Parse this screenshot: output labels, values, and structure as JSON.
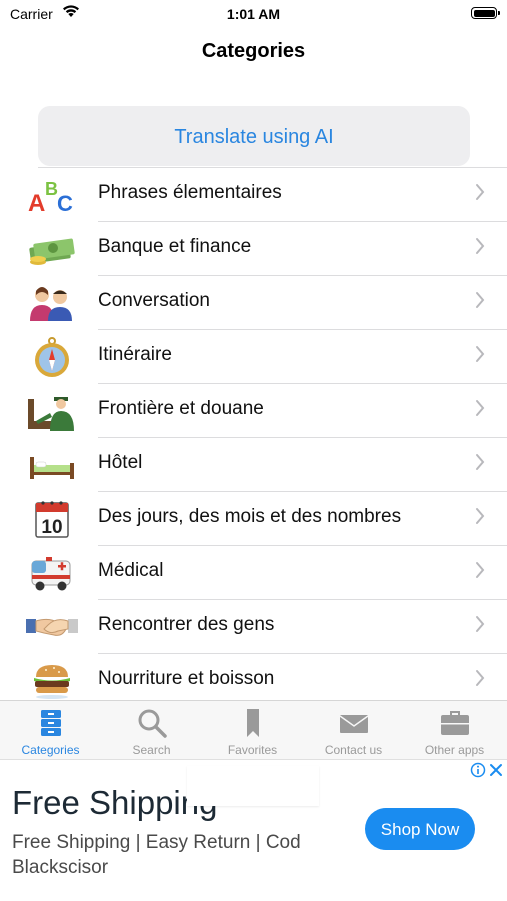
{
  "status_bar": {
    "carrier": "Carrier",
    "time": "1:01 AM"
  },
  "nav": {
    "title": "Categories"
  },
  "ai_button": {
    "label": "Translate using AI"
  },
  "categories": [
    {
      "label": "Phrases élementaires",
      "icon": "abc-blocks-icon"
    },
    {
      "label": "Banque et finance",
      "icon": "money-icon"
    },
    {
      "label": "Conversation",
      "icon": "people-talking-icon"
    },
    {
      "label": "Itinéraire",
      "icon": "compass-icon"
    },
    {
      "label": "Frontière et douane",
      "icon": "customs-officer-icon"
    },
    {
      "label": "Hôtel",
      "icon": "bed-icon"
    },
    {
      "label": "Des jours, des mois et des nombres",
      "icon": "calendar-icon"
    },
    {
      "label": "Médical",
      "icon": "ambulance-icon"
    },
    {
      "label": "Rencontrer des gens",
      "icon": "handshake-icon"
    },
    {
      "label": "Nourriture et boisson",
      "icon": "burger-icon"
    }
  ],
  "tabbar": {
    "items": [
      {
        "label": "Categories",
        "icon": "drawer-icon",
        "active": true
      },
      {
        "label": "Search",
        "icon": "search-icon",
        "active": false
      },
      {
        "label": "Favorites",
        "icon": "bookmark-icon",
        "active": false
      },
      {
        "label": "Contact us",
        "icon": "envelope-icon",
        "active": false
      },
      {
        "label": "Other apps",
        "icon": "briefcase-icon",
        "active": false
      }
    ]
  },
  "ad": {
    "title": "Free Shipping",
    "description": "Free Shipping | Easy Return | Cod Blackscisor",
    "cta": "Shop Now"
  },
  "colors": {
    "accent": "#2a86e0",
    "cta": "#1a8cf0",
    "tab_inactive": "#9a9a9a"
  }
}
